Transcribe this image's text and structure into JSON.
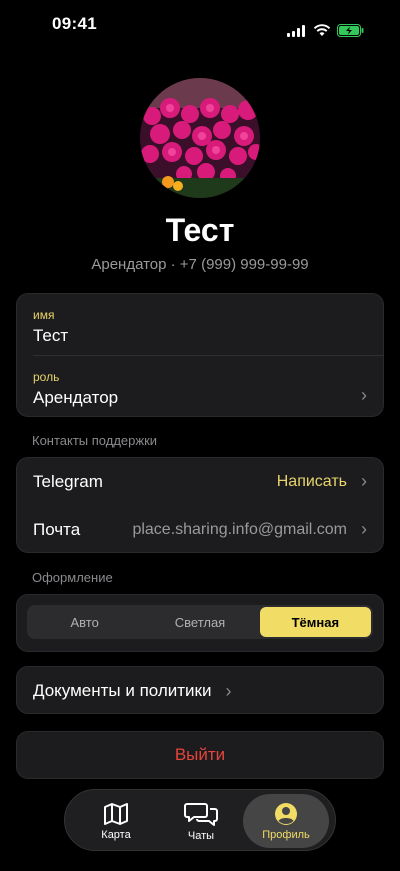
{
  "status": {
    "time": "09:41"
  },
  "profile": {
    "name": "Тест",
    "subtitle": "Арендатор · +7 (999) 999-99-99"
  },
  "info": {
    "name_label": "имя",
    "name_value": "Тест",
    "role_label": "роль",
    "role_value": "Арендатор"
  },
  "support": {
    "title": "Контакты поддержки",
    "telegram_label": "Telegram",
    "telegram_action": "Написать",
    "mail_label": "Почта",
    "mail_value": "place.sharing.info@gmail.com"
  },
  "appearance": {
    "title": "Оформление",
    "options": [
      "Авто",
      "Светлая",
      "Тёмная"
    ],
    "selected": "Тёмная"
  },
  "docs": {
    "label": "Документы и политики"
  },
  "logout": {
    "label": "Выйти"
  },
  "tabs": [
    {
      "label": "Карта",
      "icon": "map-icon"
    },
    {
      "label": "Чаты",
      "icon": "chat-icon"
    },
    {
      "label": "Профиль",
      "icon": "profile-icon"
    }
  ],
  "colors": {
    "accent": "#f1dc66",
    "danger": "#e5453a",
    "card": "#1c1c1e"
  }
}
